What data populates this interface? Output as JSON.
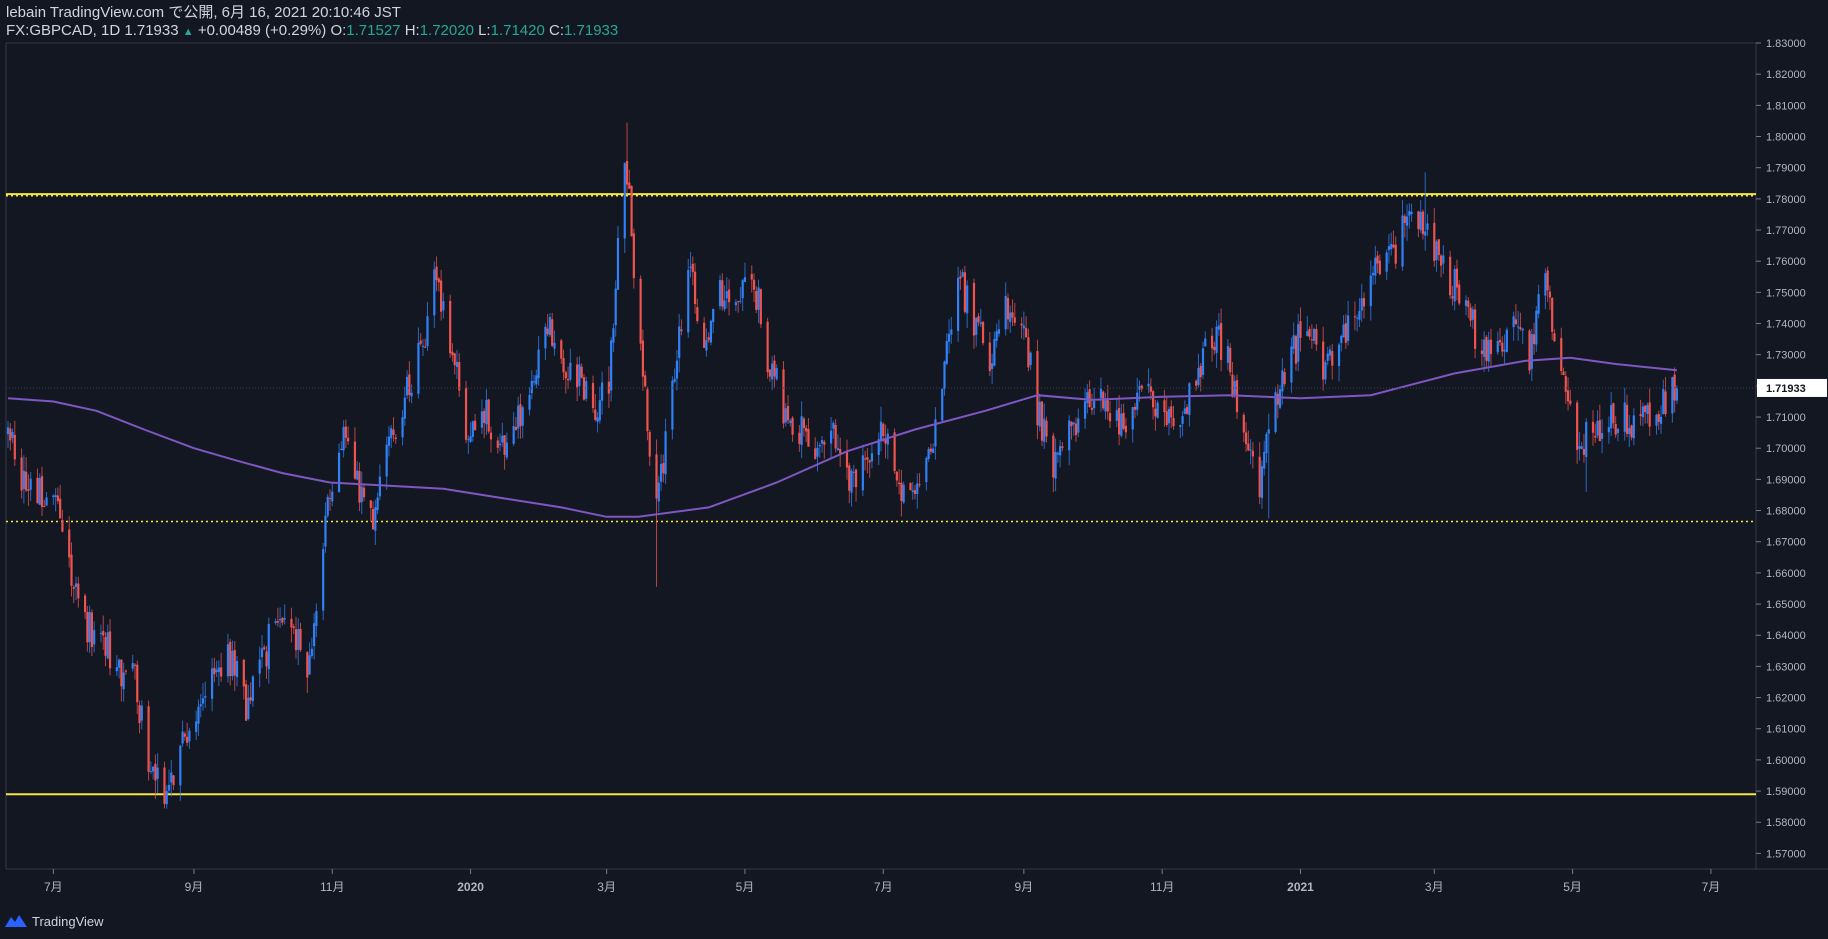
{
  "header": {
    "published": "lebain TradingView.com で公開, 6月 16, 2021 20:10:46 JST",
    "symbol": "FX:GBPCAD, 1D 1.71933",
    "arrow": "▲",
    "change": "+0.00489 (+0.29%)",
    "o_label": "O:",
    "o_value": "1.71527",
    "h_label": "H:",
    "h_value": "1.72020",
    "l_label": "L:",
    "l_value": "1.71420",
    "c_label": "C:",
    "c_value": "1.71933"
  },
  "footer": {
    "brand": "TradingView",
    "logo_icon": "tradingview-logo-icon"
  },
  "colors": {
    "background": "#131722",
    "up": "#2f81f7",
    "down": "#ef5350",
    "ma": "#7e57c2",
    "level": "#f5e642",
    "axis_text": "#b2b5be",
    "price_label_bg": "#ffffff",
    "change_color": "#26a69a"
  },
  "chart_data": {
    "type": "candlestick",
    "symbol": "FX:GBPCAD",
    "interval": "1D",
    "last_price": "1.71933",
    "ylim": [
      1.565,
      1.83
    ],
    "y_ticks": [
      "1.57000",
      "1.58000",
      "1.59000",
      "1.60000",
      "1.61000",
      "1.62000",
      "1.63000",
      "1.64000",
      "1.65000",
      "1.66000",
      "1.67000",
      "1.68000",
      "1.69000",
      "1.70000",
      "1.71000",
      "1.72000",
      "1.73000",
      "1.74000",
      "1.75000",
      "1.76000",
      "1.77000",
      "1.78000",
      "1.79000",
      "1.80000",
      "1.81000",
      "1.82000",
      "1.83000"
    ],
    "x_range": [
      "2019-06-11",
      "2021-07-20"
    ],
    "x_ticks": [
      {
        "date": "2019-07-01",
        "label": "7月"
      },
      {
        "date": "2019-09-01",
        "label": "9月"
      },
      {
        "date": "2019-11-01",
        "label": "11月"
      },
      {
        "date": "2020-01-01",
        "label": "2020"
      },
      {
        "date": "2020-03-01",
        "label": "3月"
      },
      {
        "date": "2020-05-01",
        "label": "5月"
      },
      {
        "date": "2020-07-01",
        "label": "7月"
      },
      {
        "date": "2020-09-01",
        "label": "9月"
      },
      {
        "date": "2020-11-01",
        "label": "11月"
      },
      {
        "date": "2021-01-01",
        "label": "2021"
      },
      {
        "date": "2021-03-01",
        "label": "3月"
      },
      {
        "date": "2021-05-01",
        "label": "5月"
      },
      {
        "date": "2021-07-01",
        "label": "7月"
      }
    ],
    "close_path": [
      [
        "2019-06-11",
        1.705
      ],
      [
        "2019-06-18",
        1.69
      ],
      [
        "2019-06-25",
        1.685
      ],
      [
        "2019-07-02",
        1.68
      ],
      [
        "2019-07-09",
        1.66
      ],
      [
        "2019-07-16",
        1.643
      ],
      [
        "2019-07-23",
        1.637
      ],
      [
        "2019-07-30",
        1.63
      ],
      [
        "2019-08-06",
        1.625
      ],
      [
        "2019-08-13",
        1.598
      ],
      [
        "2019-08-20",
        1.59
      ],
      [
        "2019-08-27",
        1.605
      ],
      [
        "2019-09-03",
        1.615
      ],
      [
        "2019-09-10",
        1.628
      ],
      [
        "2019-09-17",
        1.632
      ],
      [
        "2019-09-24",
        1.618
      ],
      [
        "2019-10-01",
        1.63
      ],
      [
        "2019-10-08",
        1.65
      ],
      [
        "2019-10-15",
        1.64
      ],
      [
        "2019-10-22",
        1.628
      ],
      [
        "2019-10-29",
        1.68
      ],
      [
        "2019-11-05",
        1.705
      ],
      [
        "2019-11-12",
        1.688
      ],
      [
        "2019-11-19",
        1.675
      ],
      [
        "2019-11-26",
        1.7
      ],
      [
        "2019-12-03",
        1.715
      ],
      [
        "2019-12-10",
        1.73
      ],
      [
        "2019-12-17",
        1.755
      ],
      [
        "2019-12-24",
        1.73
      ],
      [
        "2019-12-31",
        1.705
      ],
      [
        "2020-01-07",
        1.712
      ],
      [
        "2020-01-14",
        1.7
      ],
      [
        "2020-01-21",
        1.708
      ],
      [
        "2020-01-28",
        1.718
      ],
      [
        "2020-02-04",
        1.74
      ],
      [
        "2020-02-11",
        1.728
      ],
      [
        "2020-02-18",
        1.722
      ],
      [
        "2020-02-25",
        1.715
      ],
      [
        "2020-03-02",
        1.72
      ],
      [
        "2020-03-09",
        1.797
      ],
      [
        "2020-03-16",
        1.73
      ],
      [
        "2020-03-23",
        1.68
      ],
      [
        "2020-03-30",
        1.72
      ],
      [
        "2020-04-06",
        1.76
      ],
      [
        "2020-04-13",
        1.73
      ],
      [
        "2020-04-20",
        1.75
      ],
      [
        "2020-04-27",
        1.742
      ],
      [
        "2020-05-04",
        1.758
      ],
      [
        "2020-05-11",
        1.73
      ],
      [
        "2020-05-18",
        1.712
      ],
      [
        "2020-05-25",
        1.705
      ],
      [
        "2020-06-01",
        1.7
      ],
      [
        "2020-06-08",
        1.705
      ],
      [
        "2020-06-15",
        1.69
      ],
      [
        "2020-06-22",
        1.695
      ],
      [
        "2020-06-29",
        1.708
      ],
      [
        "2020-07-06",
        1.692
      ],
      [
        "2020-07-13",
        1.685
      ],
      [
        "2020-07-20",
        1.695
      ],
      [
        "2020-07-27",
        1.72
      ],
      [
        "2020-08-03",
        1.757
      ],
      [
        "2020-08-10",
        1.74
      ],
      [
        "2020-08-17",
        1.73
      ],
      [
        "2020-08-24",
        1.745
      ],
      [
        "2020-08-31",
        1.742
      ],
      [
        "2020-09-07",
        1.712
      ],
      [
        "2020-09-14",
        1.695
      ],
      [
        "2020-09-21",
        1.705
      ],
      [
        "2020-09-28",
        1.712
      ],
      [
        "2020-10-05",
        1.716
      ],
      [
        "2020-10-12",
        1.708
      ],
      [
        "2020-10-19",
        1.712
      ],
      [
        "2020-10-26",
        1.718
      ],
      [
        "2020-11-02",
        1.712
      ],
      [
        "2020-11-09",
        1.705
      ],
      [
        "2020-11-16",
        1.725
      ],
      [
        "2020-11-23",
        1.738
      ],
      [
        "2020-11-30",
        1.73
      ],
      [
        "2020-12-07",
        1.7
      ],
      [
        "2020-12-14",
        1.69
      ],
      [
        "2020-12-21",
        1.712
      ],
      [
        "2020-12-28",
        1.73
      ],
      [
        "2021-01-04",
        1.74
      ],
      [
        "2021-01-11",
        1.728
      ],
      [
        "2021-01-18",
        1.735
      ],
      [
        "2021-01-25",
        1.745
      ],
      [
        "2021-02-01",
        1.755
      ],
      [
        "2021-02-08",
        1.758
      ],
      [
        "2021-02-15",
        1.77
      ],
      [
        "2021-02-22",
        1.775
      ],
      [
        "2021-03-01",
        1.765
      ],
      [
        "2021-03-08",
        1.755
      ],
      [
        "2021-03-15",
        1.745
      ],
      [
        "2021-03-22",
        1.73
      ],
      [
        "2021-03-29",
        1.735
      ],
      [
        "2021-04-05",
        1.74
      ],
      [
        "2021-04-12",
        1.73
      ],
      [
        "2021-04-19",
        1.755
      ],
      [
        "2021-04-26",
        1.725
      ],
      [
        "2021-05-03",
        1.7
      ],
      [
        "2021-05-10",
        1.705
      ],
      [
        "2021-05-17",
        1.708
      ],
      [
        "2021-05-24",
        1.71
      ],
      [
        "2021-05-31",
        1.708
      ],
      [
        "2021-06-07",
        1.712
      ],
      [
        "2021-06-16",
        1.71933
      ]
    ],
    "series": [
      {
        "name": "MA",
        "type": "line",
        "points": [
          [
            "2019-06-11",
            1.716
          ],
          [
            "2019-07-01",
            1.715
          ],
          [
            "2019-07-20",
            1.712
          ],
          [
            "2019-08-10",
            1.706
          ],
          [
            "2019-09-01",
            1.7
          ],
          [
            "2019-09-20",
            1.696
          ],
          [
            "2019-10-10",
            1.692
          ],
          [
            "2019-10-31",
            1.689
          ],
          [
            "2019-11-25",
            1.688
          ],
          [
            "2019-12-20",
            1.687
          ],
          [
            "2020-01-15",
            1.684
          ],
          [
            "2020-02-10",
            1.681
          ],
          [
            "2020-03-01",
            1.678
          ],
          [
            "2020-03-15",
            1.678
          ],
          [
            "2020-04-15",
            1.681
          ],
          [
            "2020-05-15",
            1.689
          ],
          [
            "2020-06-15",
            1.699
          ],
          [
            "2020-07-15",
            1.706
          ],
          [
            "2020-08-15",
            1.712
          ],
          [
            "2020-09-07",
            1.717
          ],
          [
            "2020-10-01",
            1.7155
          ],
          [
            "2020-11-01",
            1.7165
          ],
          [
            "2020-12-01",
            1.717
          ],
          [
            "2021-01-01",
            1.716
          ],
          [
            "2021-02-01",
            1.717
          ],
          [
            "2021-03-10",
            1.724
          ],
          [
            "2021-04-10",
            1.728
          ],
          [
            "2021-04-30",
            1.729
          ],
          [
            "2021-05-20",
            1.727
          ],
          [
            "2021-06-16",
            1.725
          ]
        ]
      }
    ],
    "horizontal_levels": [
      {
        "price": 1.7815,
        "style": "solid"
      },
      {
        "price": 1.781,
        "style": "dotted"
      },
      {
        "price": 1.6765,
        "style": "dotted"
      },
      {
        "price": 1.589,
        "style": "solid"
      }
    ],
    "volatility_spikes": [
      {
        "date": "2019-08-15",
        "low": 1.5875
      },
      {
        "date": "2020-03-10",
        "high": 1.8045
      },
      {
        "date": "2020-03-23",
        "low": 1.6555
      },
      {
        "date": "2020-12-18",
        "low": 1.6775
      },
      {
        "date": "2021-02-25",
        "high": 1.7885
      },
      {
        "date": "2021-05-07",
        "low": 1.686
      }
    ]
  }
}
